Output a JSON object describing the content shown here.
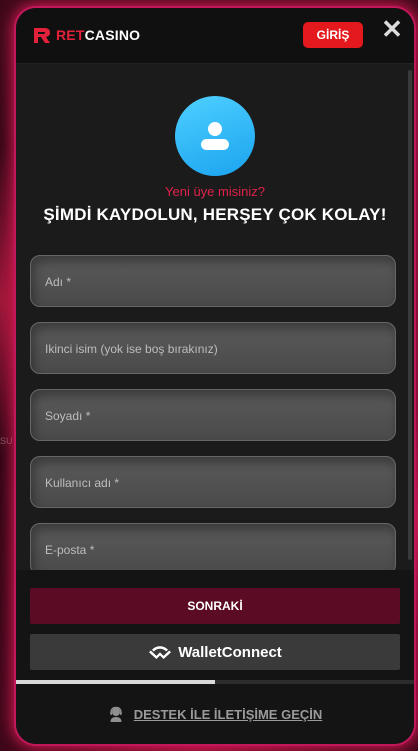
{
  "header": {
    "logo_ret": "RET",
    "logo_casino": "CASINO",
    "login_label": "GİRİŞ",
    "close_glyph": "✕"
  },
  "intro": {
    "subtitle": "Yeni üye misiniz?",
    "headline": "ŞİMDİ KAYDOLUN, HERŞEY ÇOK KOLAY!"
  },
  "form": {
    "fields": [
      {
        "label": "Adı *"
      },
      {
        "label": "Ikinci isim (yok ise boş bırakınız)"
      },
      {
        "label": "Soyadı *"
      },
      {
        "label": "Kullanıcı adı *"
      },
      {
        "label": "E-posta *"
      }
    ]
  },
  "footer": {
    "next_label": "SONRAKİ",
    "wallet_label": "WalletConnect",
    "support_label": "DESTEK İLE İLETİŞİME GEÇİN",
    "step_progress": 0.5
  },
  "background": {
    "side_text": "SU"
  },
  "colors": {
    "brand_red": "#e3213b",
    "login_red": "#e4191d",
    "accent_pink": "#e0224b",
    "next_maroon": "#5c0b24",
    "avatar_blue": "#1aa3ef"
  },
  "icons": {
    "logo": "ret-logo-icon",
    "close": "close-icon",
    "avatar": "user-avatar-icon",
    "wallet": "walletconnect-icon",
    "support": "support-agent-icon"
  }
}
